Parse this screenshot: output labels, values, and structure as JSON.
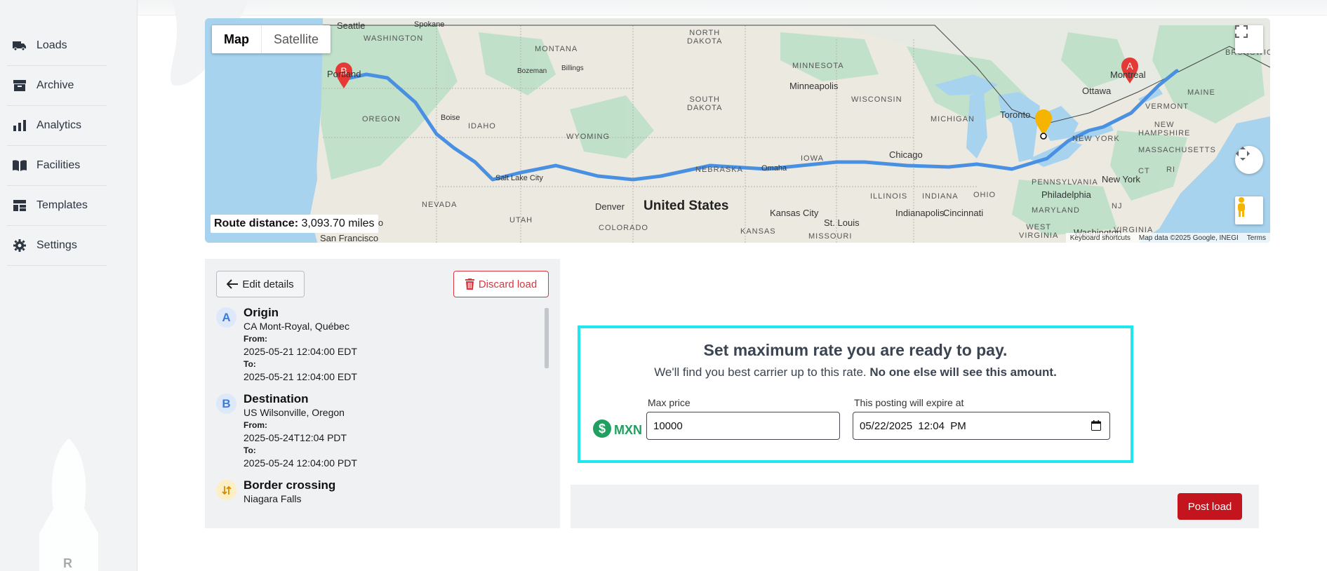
{
  "sidebar": {
    "items": [
      {
        "label": "Loads",
        "icon": "truck-icon"
      },
      {
        "label": "Archive",
        "icon": "archive-box-icon"
      },
      {
        "label": "Analytics",
        "icon": "bar-chart-icon"
      },
      {
        "label": "Facilities",
        "icon": "book-open-icon"
      },
      {
        "label": "Templates",
        "icon": "layout-template-icon"
      },
      {
        "label": "Settings",
        "icon": "gear-icon"
      }
    ],
    "logo_mark": "R"
  },
  "map": {
    "toggle": {
      "map_label": "Map",
      "satellite_label": "Satellite",
      "active": "Map"
    },
    "route_distance_label": "Route distance:",
    "route_distance_value": "3,093.70 miles",
    "footer": {
      "shortcuts": "Keyboard shortcuts",
      "data": "Map data ©2025 Google, INEGI",
      "terms": "Terms"
    },
    "markers": {
      "a": "A",
      "b": "B"
    },
    "places": {
      "seattle": "Seattle",
      "spokane": "Spokane",
      "washington_state": "WASHINGTON",
      "portland": "Portland",
      "oregon": "OREGON",
      "idaho": "IDAHO",
      "boise": "Boise",
      "bozeman": "Bozeman",
      "billings": "Billings",
      "montana": "MONTANA",
      "wyoming": "WYOMING",
      "north_dakota": "NORTH\nDAKOTA",
      "south_dakota": "SOUTH\nDAKOTA",
      "minnesota": "MINNESOTA",
      "minneapolis": "Minneapolis",
      "wisconsin": "WISCONSIN",
      "michigan": "MICHIGAN",
      "nevada": "NEVADA",
      "utah": "UTAH",
      "salt_lake_city": "Salt Lake City",
      "denver": "Denver",
      "colorado": "COLORADO",
      "united_states": "United States",
      "nebraska": "NEBRASKA",
      "omaha": "Omaha",
      "iowa": "IOWA",
      "kansas": "KANSAS",
      "kansas_city": "Kansas City",
      "st_louis": "St. Louis",
      "missouri": "MISSOURI",
      "illinois": "ILLINOIS",
      "indiana": "INDIANA",
      "chicago": "Chicago",
      "indianapolis": "Indianapolis",
      "cincinnati": "Cincinnati",
      "ohio": "OHIO",
      "toronto": "Toronto",
      "ottawa": "Ottawa",
      "montreal": "Montreal",
      "maine": "MAINE",
      "vermont": "VERMONT",
      "new_hampshire": "NEW\nHAMPSHIRE",
      "massachusetts": "MASSACHUSETTS",
      "new_york_state": "NEW YORK",
      "new_york": "New York",
      "pennsylvania": "PENNSYLVANIA",
      "philadelphia": "Philadelphia",
      "maryland": "MARYLAND",
      "washington_dc": "Washington",
      "west_virginia": "WEST\nVIRGINIA",
      "virginia": "VIRGINIA",
      "ri": "RI",
      "ct": "CT",
      "nj": "NJ",
      "brunswick": "BRUNSWIC",
      "san_francisco": "San Francisco",
      "sacramento": "nto"
    }
  },
  "details": {
    "edit_label": "Edit details",
    "discard_label": "Discard load",
    "stops": [
      {
        "badge": "A",
        "title": "Origin",
        "location": "CA Mont-Royal, Québec",
        "from_label": "From:",
        "from": "2025-05-21 12:04:00 EDT",
        "to_label": "To:",
        "to": "2025-05-21 12:04:00 EDT"
      },
      {
        "badge": "B",
        "title": "Destination",
        "location": "US Wilsonville, Oregon",
        "from_label": "From:",
        "from": "2025-05-24T12:04 PDT",
        "to_label": "To:",
        "to": "2025-05-24 12:04:00 PDT"
      }
    ],
    "border": {
      "title": "Border crossing",
      "location": "Niagara Falls"
    }
  },
  "rate": {
    "title": "Set maximum rate you are ready to pay.",
    "subtitle_plain": "We'll find you best carrier up to this rate.",
    "subtitle_bold": "No one else will see this amount.",
    "currency": "MXN",
    "max_price_label": "Max price",
    "max_price_value": "10000",
    "expire_label": "This posting will expire at",
    "expire_value": "05/22/2025  12:04  PM"
  },
  "post_label": "Post load",
  "colors": {
    "route": "#4a90e2",
    "marker_red": "#e53935",
    "marker_yellow": "#f5b400",
    "accent_cyan": "#1de8f0",
    "post_red": "#c4151e",
    "currency_green": "#1fa060"
  }
}
